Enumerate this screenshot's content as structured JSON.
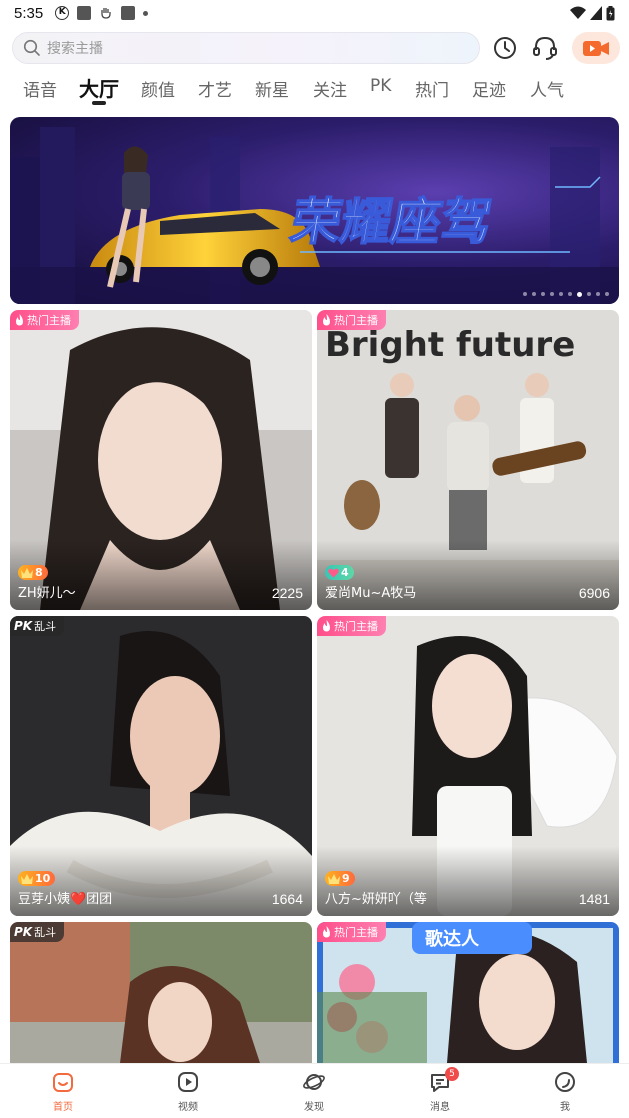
{
  "status_bar": {
    "time": "5:35",
    "icons": [
      "k-icon",
      "app-square-icon",
      "hand-icon",
      "app-square-icon",
      "dot-icon"
    ],
    "right_icons": [
      "wifi-icon",
      "signal-icon",
      "battery-icon"
    ]
  },
  "search": {
    "placeholder": "搜索主播"
  },
  "header_icons": [
    "history-clock-icon",
    "headset-service-icon",
    "start-live-camera-icon"
  ],
  "tabs": [
    {
      "label": "语音"
    },
    {
      "label": "大厅",
      "active": true
    },
    {
      "label": "颜值"
    },
    {
      "label": "才艺"
    },
    {
      "label": "新星"
    },
    {
      "label": "关注"
    },
    {
      "label": "PK"
    },
    {
      "label": "热门"
    },
    {
      "label": "足迹"
    },
    {
      "label": "人气"
    }
  ],
  "banner": {
    "title": "荣耀座驾",
    "dot_count": 10,
    "active_dot": 7
  },
  "cards": [
    {
      "badge": "热门主播",
      "badge_type": "hot",
      "level": "8",
      "level_type": "gold",
      "name": "ZH妍儿～",
      "count": "2225"
    },
    {
      "badge": "热门主播",
      "badge_type": "hot",
      "level": "4",
      "level_type": "pink",
      "name": "爱尚Mu~A牧马",
      "count": "6906",
      "photo_text": "Bright future"
    },
    {
      "badge": "乱斗",
      "badge_prefix": "PK",
      "badge_type": "pk",
      "level": "10",
      "level_type": "gold",
      "name": "豆芽小姨❤️团团",
      "count": "1664"
    },
    {
      "badge": "热门主播",
      "badge_type": "hot",
      "level": "9",
      "level_type": "gold",
      "name": "八方~妍妍吖（等",
      "count": "1481"
    },
    {
      "badge": "乱斗",
      "badge_prefix": "PK",
      "badge_type": "pk"
    },
    {
      "badge": "热门主播",
      "badge_type": "hot",
      "photo_text": "歌达人"
    }
  ],
  "bottom_nav": [
    {
      "label": "首页",
      "icon": "home-icon",
      "active": true
    },
    {
      "label": "视频",
      "icon": "video-play-icon"
    },
    {
      "label": "发现",
      "icon": "planet-icon"
    },
    {
      "label": "消息",
      "icon": "message-icon",
      "badge": "5"
    },
    {
      "label": "我",
      "icon": "profile-icon"
    }
  ],
  "colors": {
    "accent": "#f26a3d",
    "hot_badge": "#ff4f8a",
    "message_badge": "#f04a4a"
  }
}
